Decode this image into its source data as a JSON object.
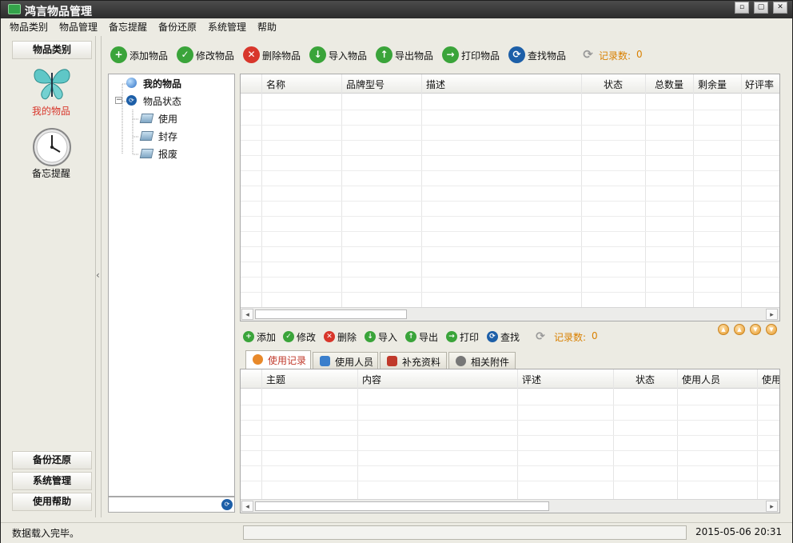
{
  "window": {
    "title": "鸿言物品管理",
    "btn_min": "▫",
    "btn_max": "▢",
    "btn_close": "✕"
  },
  "menu": [
    "物品类别",
    "物品管理",
    "备忘提醒",
    "备份还原",
    "系统管理",
    "帮助"
  ],
  "sidebar": {
    "header": "物品类别",
    "items": [
      {
        "label": "我的物品",
        "icon": "butterfly-icon",
        "active": true
      },
      {
        "label": "备忘提醒",
        "icon": "clock-icon",
        "active": false
      }
    ],
    "bottom_buttons": [
      "备份还原",
      "系统管理",
      "使用帮助"
    ]
  },
  "toolbar": {
    "buttons": [
      {
        "label": "添加物品",
        "icon": "add-icon",
        "symbol": "+",
        "color": "#3aa43a"
      },
      {
        "label": "修改物品",
        "icon": "check-icon",
        "symbol": "✓",
        "color": "#3aa43a"
      },
      {
        "label": "删除物品",
        "icon": "delete-icon",
        "symbol": "✕",
        "color": "#d8362b"
      },
      {
        "label": "导入物品",
        "icon": "import-icon",
        "symbol": "↓",
        "color": "#3aa43a"
      },
      {
        "label": "导出物品",
        "icon": "export-icon",
        "symbol": "↑",
        "color": "#3aa43a"
      },
      {
        "label": "打印物品",
        "icon": "print-icon",
        "symbol": "→",
        "color": "#3aa43a"
      },
      {
        "label": "查找物品",
        "icon": "search-icon",
        "symbol": "⟳",
        "color": "#1d5fa8"
      }
    ],
    "record_label": "记录数:",
    "record_count": "0"
  },
  "tree": {
    "root": "我的物品",
    "status_node": "物品状态",
    "children": [
      "使用",
      "封存",
      "报废"
    ]
  },
  "main_grid": {
    "columns": [
      "名称",
      "品牌型号",
      "描述",
      "状态",
      "总数量",
      "剩余量",
      "好评率"
    ]
  },
  "sub_toolbar": {
    "buttons": [
      {
        "label": "添加",
        "icon": "add-icon",
        "symbol": "+",
        "color": "#3aa43a"
      },
      {
        "label": "修改",
        "icon": "check-icon",
        "symbol": "✓",
        "color": "#3aa43a"
      },
      {
        "label": "删除",
        "icon": "delete-icon",
        "symbol": "✕",
        "color": "#d8362b"
      },
      {
        "label": "导入",
        "icon": "import-icon",
        "symbol": "↓",
        "color": "#3aa43a"
      },
      {
        "label": "导出",
        "icon": "export-icon",
        "symbol": "↑",
        "color": "#3aa43a"
      },
      {
        "label": "打印",
        "icon": "print-icon",
        "symbol": "→",
        "color": "#3aa43a"
      },
      {
        "label": "查找",
        "icon": "search-icon",
        "symbol": "⟳",
        "color": "#1d5fa8"
      }
    ],
    "record_label": "记录数:",
    "record_count": "0"
  },
  "tabs": [
    {
      "label": "使用记录",
      "icon": "record-icon",
      "color": "#e8892a",
      "active": true
    },
    {
      "label": "使用人员",
      "icon": "users-icon",
      "color": "#3b7fcc",
      "active": false
    },
    {
      "label": "补充资料",
      "icon": "books-icon",
      "color": "#c0392b",
      "active": false
    },
    {
      "label": "相关附件",
      "icon": "paperclip-icon",
      "color": "#777777",
      "active": false
    }
  ],
  "detail_grid": {
    "columns": [
      "主题",
      "内容",
      "评述",
      "状态",
      "使用人员",
      "使用"
    ]
  },
  "status": {
    "message": "数据载入完毕。",
    "datetime": "2015-05-06 20:31"
  }
}
